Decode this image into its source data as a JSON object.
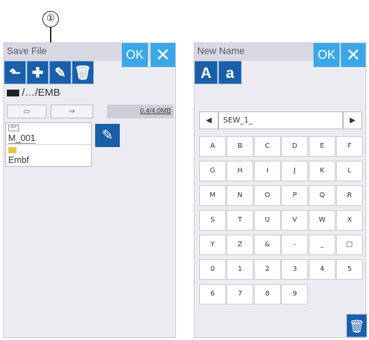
{
  "callout": {
    "label": "①"
  },
  "left": {
    "title": "Save File",
    "ok_label": "OK",
    "close_label": "✕",
    "toolbar": [
      {
        "name": "up-folder-button",
        "icon": "up-arrow-icon",
        "glyph": "⬑"
      },
      {
        "name": "new-folder-button",
        "icon": "new-folder-icon",
        "glyph": "✚"
      },
      {
        "name": "rename-button",
        "icon": "pencil-icon",
        "glyph": "✎"
      },
      {
        "name": "delete-button",
        "icon": "trash-icon",
        "glyph": "🗑"
      }
    ],
    "path": "/…/EMB",
    "device_buttons": [
      "▭",
      "⇒"
    ],
    "memory": "0.4/4.0MB",
    "files": [
      {
        "tag": "JEF",
        "name": "M_001",
        "type": "design",
        "selected": true
      },
      {
        "name": "Embf",
        "type": "folder",
        "selected": false
      }
    ],
    "edit_glyph": "✎"
  },
  "right": {
    "title": "New Name",
    "ok_label": "OK",
    "close_label": "✕",
    "upper_label": "A",
    "lower_label": "a",
    "name_value": "SEW_1_",
    "left_arrow": "◀",
    "right_arrow": "▶",
    "keys": [
      [
        "A",
        "B",
        "C",
        "D",
        "E",
        "F"
      ],
      [
        "G",
        "H",
        "I",
        "J",
        "K",
        "L"
      ],
      [
        "M",
        "N",
        "O",
        "P",
        "Q",
        "R"
      ],
      [
        "S",
        "T",
        "U",
        "V",
        "W",
        "X"
      ],
      [
        "Y",
        "Z",
        "&",
        "-",
        "_",
        "□"
      ],
      [
        "0",
        "1",
        "2",
        "3",
        "4",
        "5"
      ],
      [
        "6",
        "7",
        "8",
        "9"
      ]
    ],
    "trash_glyph": "🗑"
  }
}
